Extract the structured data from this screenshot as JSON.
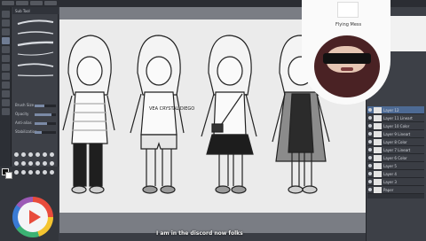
{
  "subtool": {
    "header": "Sub Tool",
    "props": [
      {
        "label": "Brush Size",
        "value": 0.45
      },
      {
        "label": "Opacity",
        "value": 0.8
      },
      {
        "label": "Anti-alias",
        "value": 0.6
      },
      {
        "label": "Stabilization",
        "value": 0.35
      }
    ]
  },
  "layers": {
    "items": [
      {
        "name": "Layer 12"
      },
      {
        "name": "Layer 11 Lineart"
      },
      {
        "name": "Layer 10 Color"
      },
      {
        "name": "Layer 9 Lineart"
      },
      {
        "name": "Layer 8 Color"
      },
      {
        "name": "Layer 7 Lineart"
      },
      {
        "name": "Layer 6 Color"
      },
      {
        "name": "Layer 5"
      },
      {
        "name": "Layer 4"
      },
      {
        "name": "Layer 3"
      },
      {
        "name": "Paper"
      }
    ],
    "active_index": 0
  },
  "canvas": {
    "shirt_text": "VEA CRYSTAL DIEGO"
  },
  "cam": {
    "cup_text": "Flying Mess"
  },
  "caption": {
    "text": "I am in the discord now folks"
  },
  "colors": {
    "accent": "#4d6a94",
    "panel": "#3d4047",
    "canvas": "#ebebeb"
  }
}
